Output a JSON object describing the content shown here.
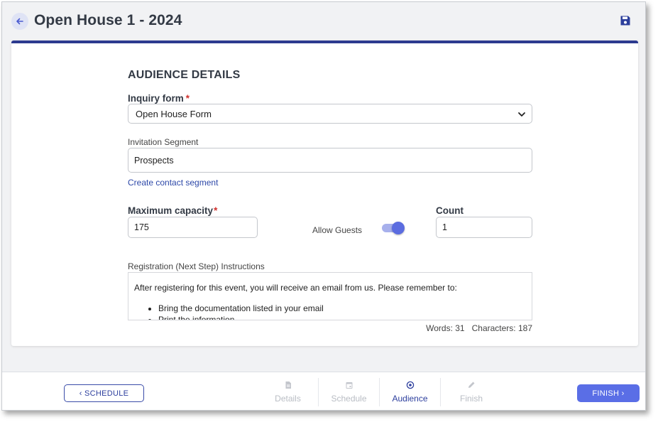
{
  "header": {
    "title": "Open House 1 - 2024",
    "back_icon": "arrow-left-icon",
    "save_icon": "floppy-disk-icon"
  },
  "audience": {
    "section_title": "AUDIENCE DETAILS",
    "inquiry_form": {
      "label": "Inquiry form",
      "required_marker": "*",
      "value": "Open House Form"
    },
    "invitation_segment": {
      "label": "Invitation Segment",
      "value": "Prospects"
    },
    "create_segment_link": "Create contact segment",
    "max_capacity": {
      "label": "Maximum capacity",
      "required_marker": "*",
      "value": "175"
    },
    "allow_guests": {
      "label": "Allow Guests",
      "enabled": true
    },
    "count": {
      "label": "Count",
      "value": "1"
    },
    "instructions": {
      "label": "Registration (Next Step) Instructions",
      "intro": "After registering for this event, you will receive an email from us. Please remember to:",
      "bullets": [
        "Bring the documentation listed in your email",
        "Print the information"
      ],
      "counter": "Words: 31   Characters: 187"
    }
  },
  "footer": {
    "prev_button": "‹ SCHEDULE",
    "next_button": "FINISH ›",
    "steps": [
      {
        "label": "Details",
        "icon": "document-icon",
        "state": "disabled"
      },
      {
        "label": "Schedule",
        "icon": "calendar-icon",
        "state": "disabled"
      },
      {
        "label": "Audience",
        "icon": "target-icon",
        "state": "active"
      },
      {
        "label": "Finish",
        "icon": "pencil-icon",
        "state": "disabled"
      }
    ]
  },
  "colors": {
    "accent": "#2c3a8f",
    "primary_button": "#5a6ee6",
    "link": "#2d48a8",
    "required": "#d0312d"
  }
}
